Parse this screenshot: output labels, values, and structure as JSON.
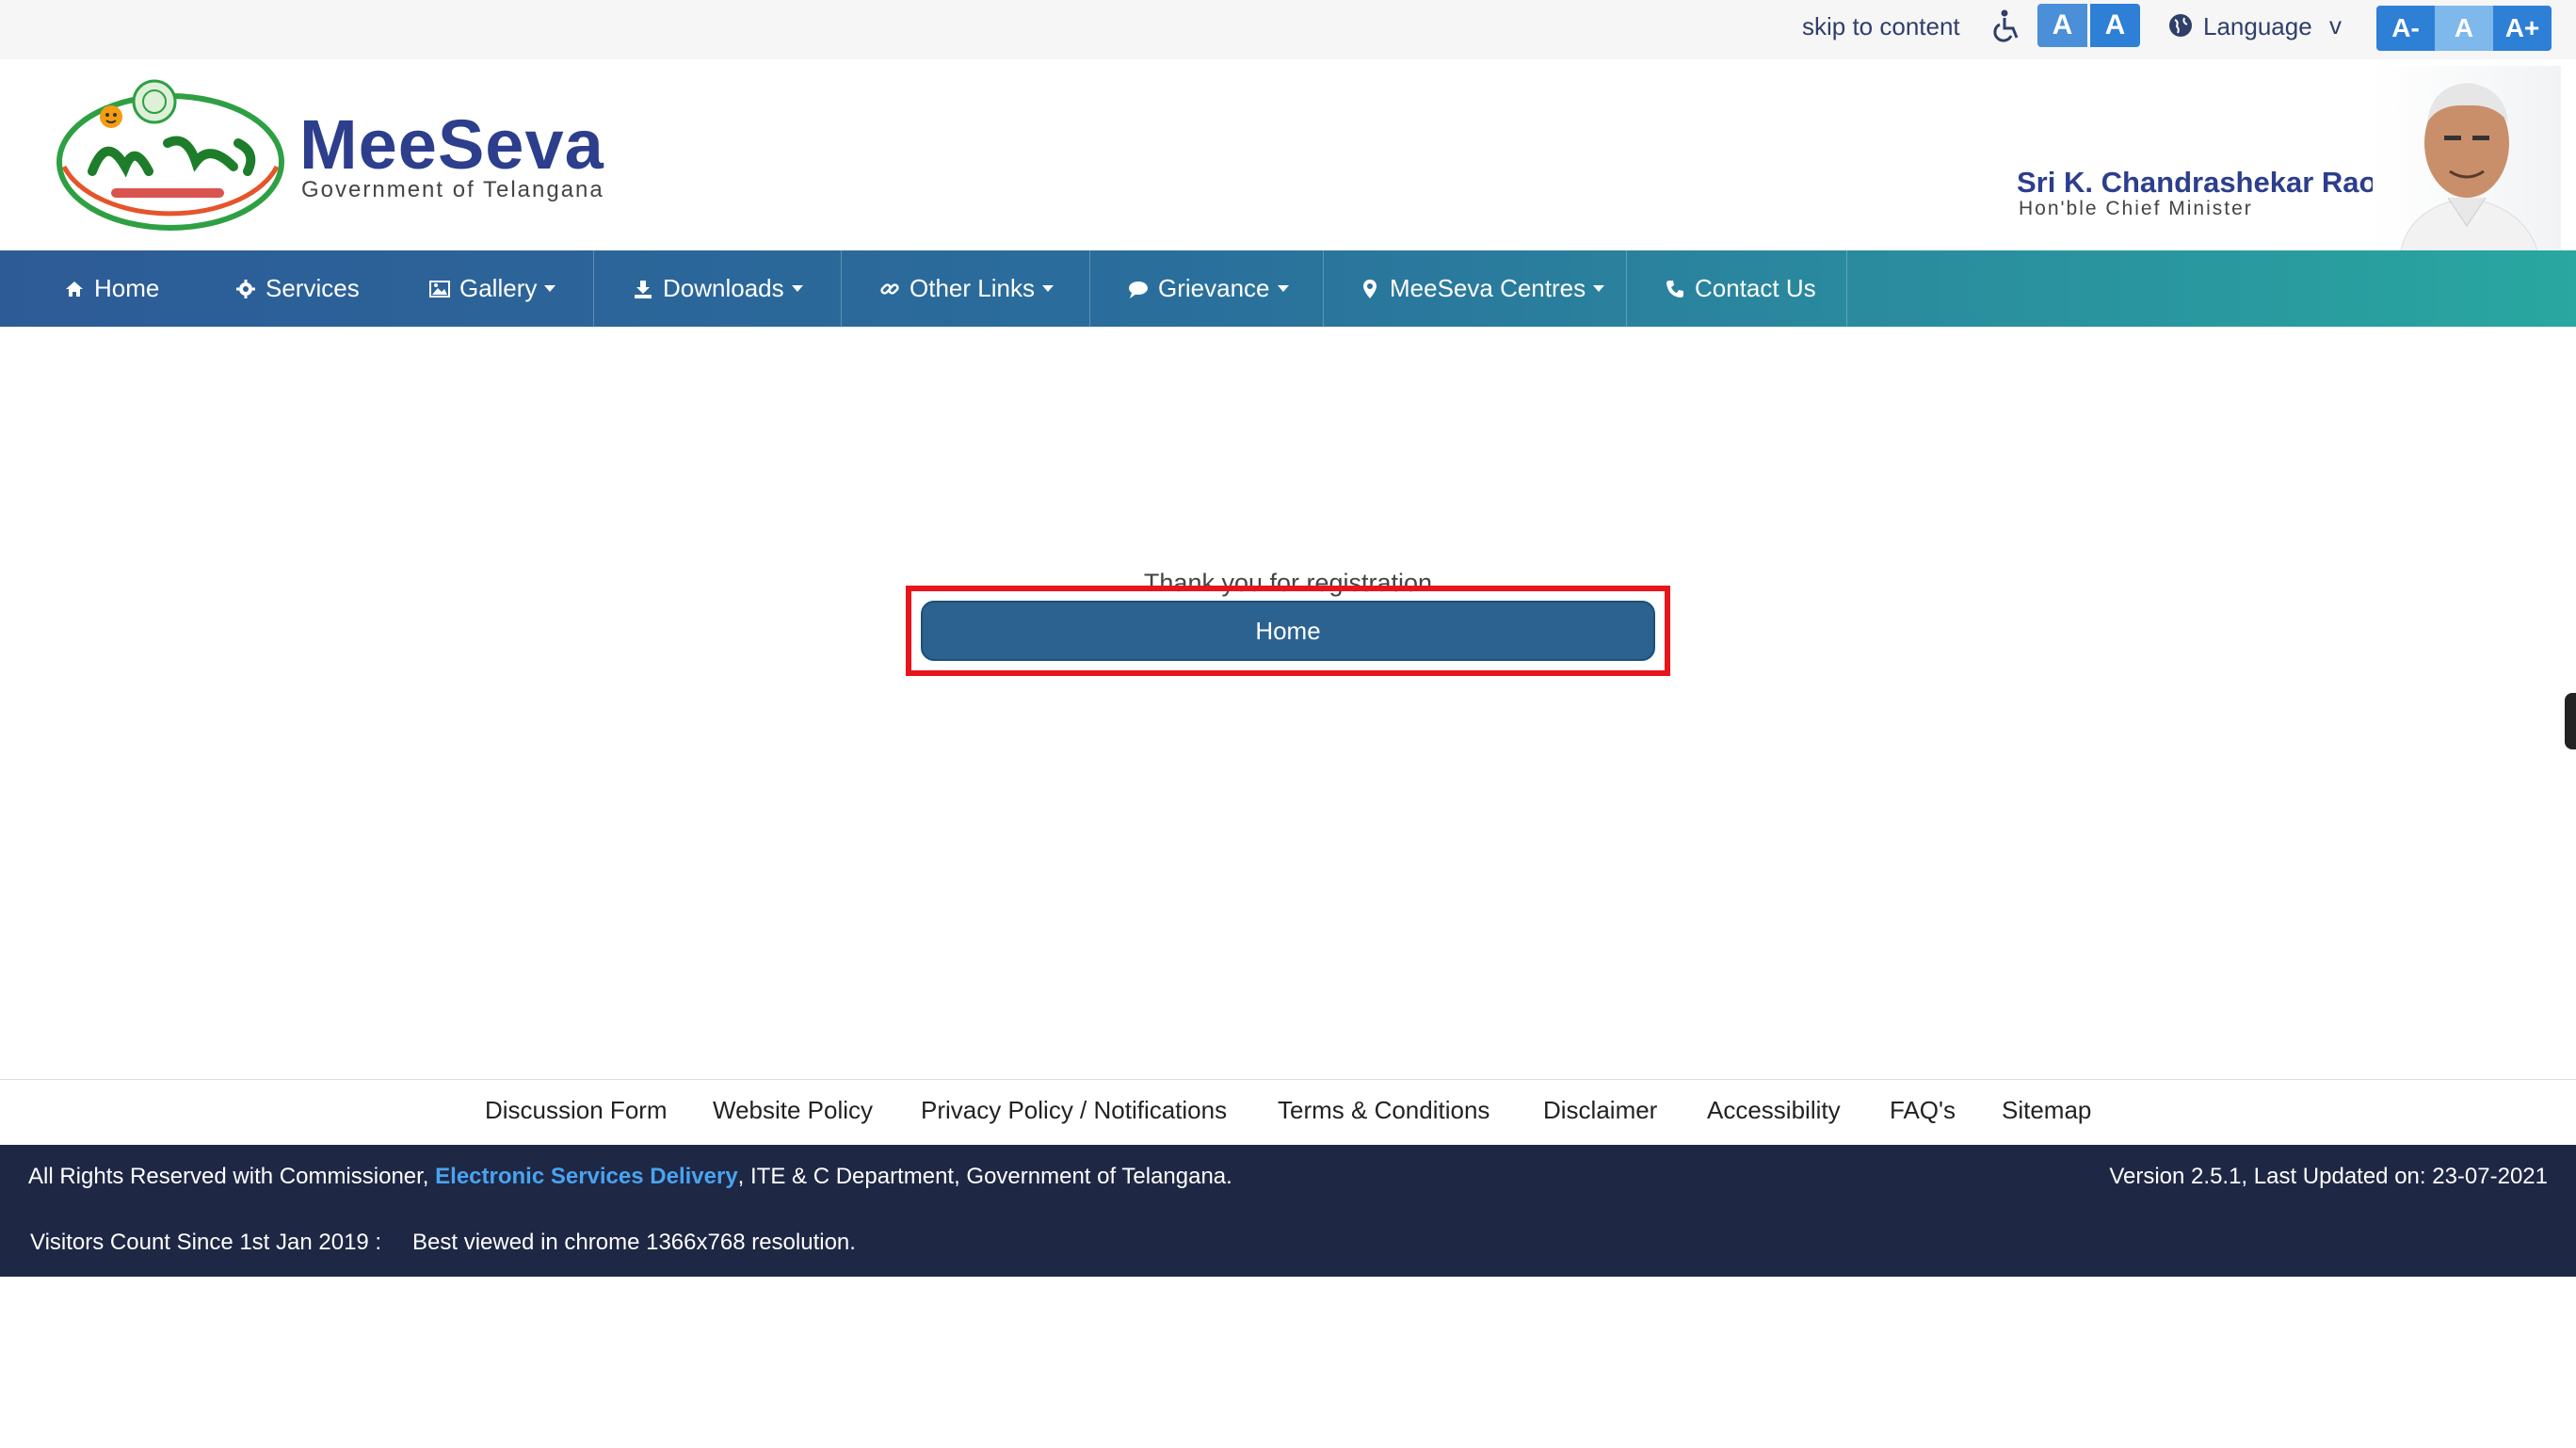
{
  "topbar": {
    "skip_label": "skip to content",
    "contrast": [
      "A",
      "A"
    ],
    "language_label": "Language",
    "language_chevron": "v",
    "font_sizes": [
      "A-",
      "A",
      "A+"
    ]
  },
  "header": {
    "brand": "MeeSeva",
    "brand_sub": "Government of Telangana",
    "cm_name": "Sri K. Chandrashekar Rao",
    "cm_title": "Hon'ble Chief Minister"
  },
  "nav": {
    "items": [
      {
        "label": "Home",
        "icon": "home-icon"
      },
      {
        "label": "Services",
        "icon": "gear-icon"
      },
      {
        "label": "Gallery",
        "icon": "image-icon"
      },
      {
        "label": "Downloads",
        "icon": "download-icon"
      },
      {
        "label": "Other Links",
        "icon": "link-icon"
      },
      {
        "label": "Grievance",
        "icon": "comment-icon"
      },
      {
        "label": "MeeSeva Centres",
        "icon": "map-marker-icon"
      },
      {
        "label": "Contact Us",
        "icon": "phone-icon"
      }
    ]
  },
  "main": {
    "message": "Thank you for registration",
    "home_button": "Home"
  },
  "footer_links": [
    "Discussion Form",
    "Website Policy",
    "Privacy Policy / Notifications",
    "Terms & Conditions",
    "Disclaimer",
    "Accessibility",
    "FAQ's",
    "Sitemap"
  ],
  "footer": {
    "rights_prefix": "All Rights Reserved with Commissioner, ",
    "rights_link": "Electronic Services Delivery",
    "rights_suffix": ", ITE & C Department, Government of Telangana.",
    "version": "Version 2.5.1, Last Updated on: 23-07-2021",
    "visitors": "Visitors Count Since 1st Jan 2019 :",
    "best_viewed": "Best viewed in chrome 1366x768 resolution."
  },
  "colors": {
    "brand": "#2c3e8c",
    "nav_start": "#2d5b96",
    "nav_end": "#29a7a0",
    "button": "#2b6290",
    "highlight": "#e8141c",
    "footer_bg": "#1e2744"
  }
}
